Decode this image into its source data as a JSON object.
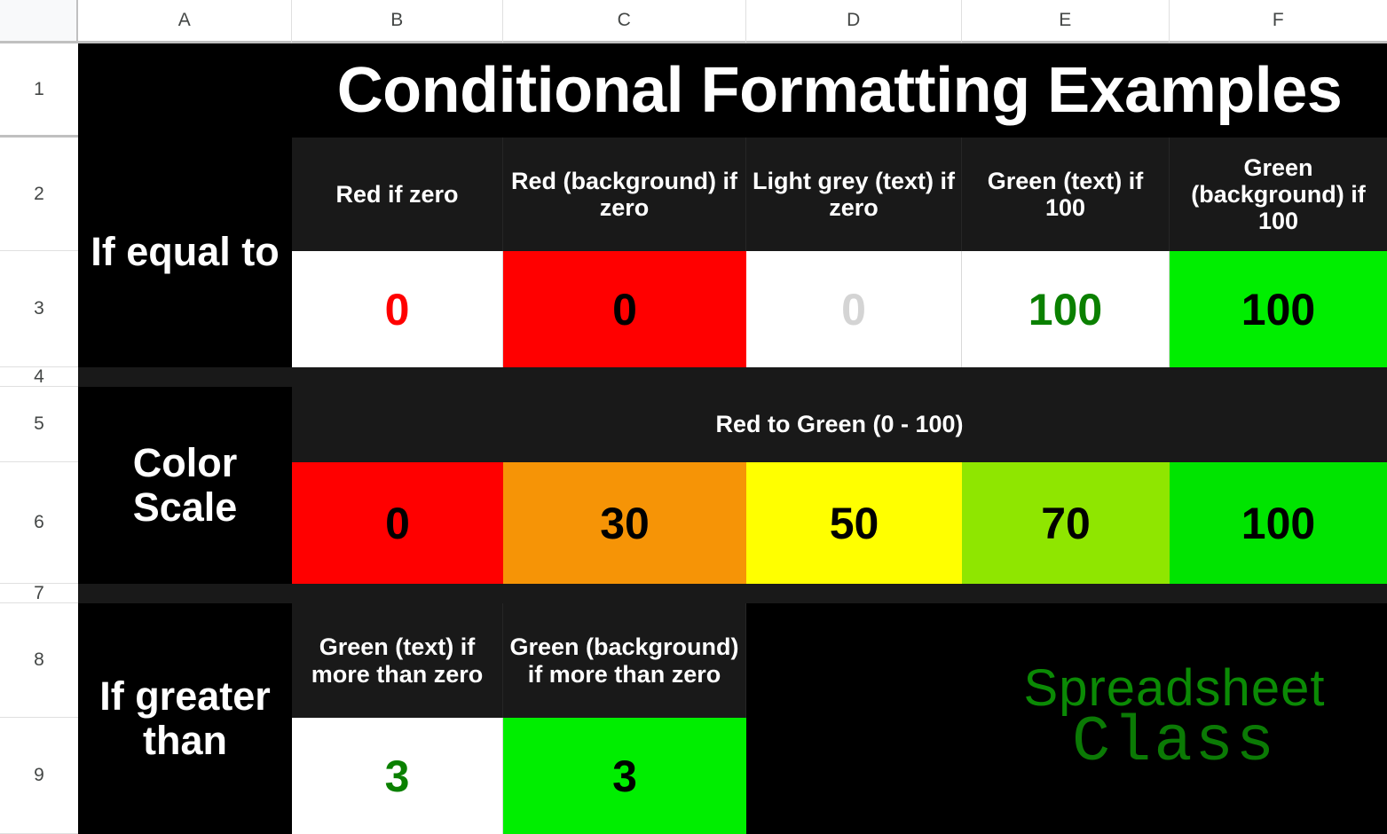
{
  "spreadsheet": {
    "column_headers": [
      "A",
      "B",
      "C",
      "D",
      "E",
      "F"
    ],
    "row_headers": [
      "1",
      "2",
      "3",
      "4",
      "5",
      "6",
      "7",
      "8",
      "9"
    ],
    "title": "Conditional Formatting Examples",
    "sections": {
      "if_equal_to": {
        "label": "If equal to",
        "headers": [
          "Red if zero",
          "Red (background) if zero",
          "Light grey (text) if zero",
          "Green (text) if 100",
          "Green (background) if 100"
        ],
        "values": [
          "0",
          "0",
          "0",
          "100",
          "100"
        ]
      },
      "color_scale": {
        "label": "Color Scale",
        "header": "Red to Green (0 - 100)",
        "values": [
          "0",
          "30",
          "50",
          "70",
          "100"
        ]
      },
      "if_greater_than": {
        "label": "If greater than",
        "headers": [
          "Green (text) if more than zero",
          "Green (background) if more than zero"
        ],
        "values": [
          "3",
          "3"
        ]
      }
    },
    "watermark": {
      "line1": "Spreadsheet",
      "line2": "Class"
    },
    "colors": {
      "red": "#ff0000",
      "green_bright": "#00ee00",
      "green_text": "#0a8000",
      "light_grey_text": "#d4d4d4",
      "orange": "#f69406",
      "yellow": "#ffff00",
      "yellow_green": "#8fe600",
      "black": "#000000",
      "charcoal": "#191919",
      "white": "#ffffff"
    }
  }
}
